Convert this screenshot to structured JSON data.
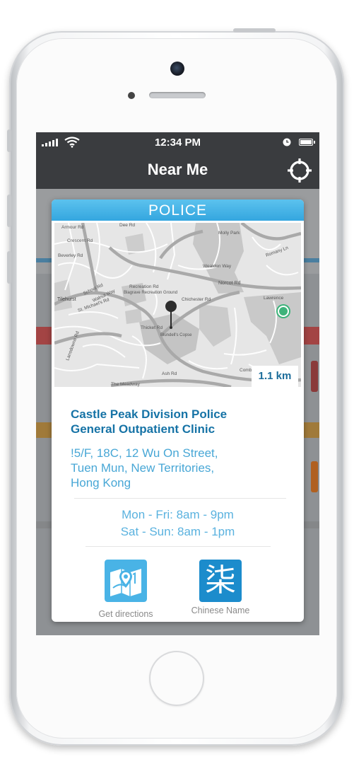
{
  "status_bar": {
    "time": "12:34 PM"
  },
  "nav": {
    "title": "Near Me"
  },
  "card": {
    "category": "POLICE",
    "distance": "1.1 km",
    "name_lines": [
      "Castle Peak Division Police",
      "General Outpatient Clinic"
    ],
    "address_lines": [
      "!5/F, 18C, 12 Wu On Street,",
      "Tuen Mun, New Territories,",
      "Hong Kong"
    ],
    "hours": [
      "Mon - Fri: 8am - 9pm",
      "Sat - Sun: 8am - 1pm"
    ],
    "actions": [
      {
        "label": "Get directions",
        "icon": "map-directions-icon"
      },
      {
        "label": "Chinese Name",
        "icon": "chinese-character-icon",
        "glyph": "柒"
      }
    ]
  },
  "map_labels": {
    "roads": [
      "Armour Rd",
      "Crescent Rd",
      "Beverley Rd",
      "School Rd",
      "Tilehurst",
      "Norcot Rd",
      "Romany Ln",
      "Wealden Way",
      "Dee Rd",
      "Recreation Rd",
      "Chichester Rd",
      "Thicket Rd",
      "Combe Rd",
      "Ash Rd",
      "Lansdowne Rd",
      "The Meadway",
      "Molly Park",
      "St. Michael's Rd",
      "Walnut Way",
      "Lawrence"
    ],
    "places": [
      "Blagrave Recreation Ground",
      "Blundell's Copse"
    ]
  },
  "colors": {
    "header_blue": "#34a6df",
    "title_blue": "#1673a6",
    "text_blue": "#48a7d6",
    "bar_dark": "#3a3c3f",
    "marker_green": "#3db37a"
  }
}
